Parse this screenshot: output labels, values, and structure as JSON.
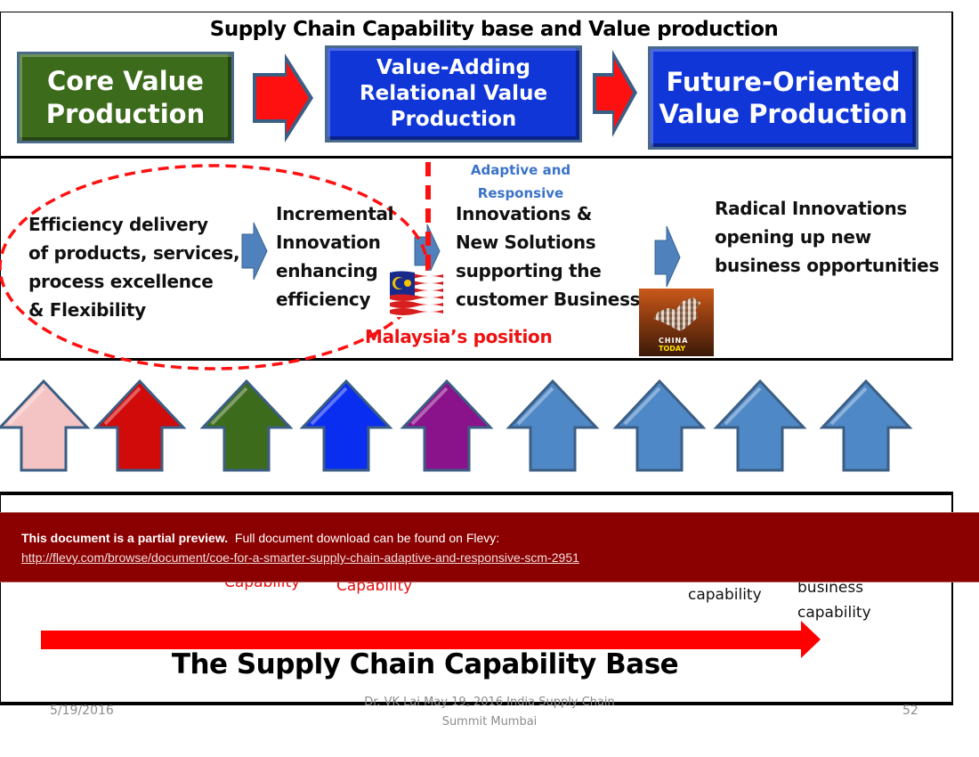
{
  "slide": {
    "title": "Supply Chain Capability base  and Value production",
    "value_boxes": [
      {
        "label": "Core Value\nProduction",
        "color": "#3d6b1c"
      },
      {
        "label": "Value-Adding\nRelational Value\nProduction",
        "color": "#1036d8"
      },
      {
        "label": "Future-Oriented\nValue Production",
        "color": "#1036d8"
      }
    ],
    "stages": [
      {
        "text": "Efficiency delivery\nof products, services,\nprocess excellence\n& Flexibility"
      },
      {
        "text": "Incremental\nInnovation\nenhancing\nefficiency"
      },
      {
        "text": "Innovations  &\nNew  Solutions\nsupporting the\ncustomer  Business"
      },
      {
        "text": "Radical Innovations\nopening up new\nbusiness opportunities"
      }
    ],
    "adaptive_label": "Adaptive and\nResponsive",
    "malaysia_label": "Malaysia’s position",
    "china_image_label": {
      "main": "CHINA",
      "accent": "TODAY"
    },
    "flag_icon": "malaysia-flag",
    "up_arrows": [
      {
        "color": "#f4c4c4",
        "name": "pink"
      },
      {
        "color": "#d10a0a",
        "name": "red"
      },
      {
        "color": "#3d6b1c",
        "name": "green"
      },
      {
        "color": "#0a2ef0",
        "name": "blue"
      },
      {
        "color": "#8a128a",
        "name": "purple"
      },
      {
        "color": "#4f88c6",
        "name": "steel-blue-1"
      },
      {
        "color": "#4f88c6",
        "name": "steel-blue-2"
      },
      {
        "color": "#4f88c6",
        "name": "steel-blue-3"
      },
      {
        "color": "#4f88c6",
        "name": "steel-blue-4"
      }
    ],
    "capabilities": {
      "red_1": "Capability",
      "red_2": "Capability",
      "black_1": "capability",
      "black_2": "business\ncapability"
    },
    "bottom_title": "The Supply Chain Capability Base"
  },
  "banner": {
    "bold_text": "This document is a partial preview.",
    "text": "Full document download can be found on Flevy:",
    "link": "http://flevy.com/browse/document/coe-for-a-smarter-supply-chain-adaptive-and-responsive-scm-2951"
  },
  "footer": {
    "date": "5/19/2016",
    "center": "Dr. VK Lai May 19, 2016 India Supply Chain\nSummit Mumbai",
    "page": "52"
  },
  "colors": {
    "banner_bg": "#8b0000",
    "accent_red": "#ff0000",
    "arrow_blue": "#4f81bd"
  }
}
